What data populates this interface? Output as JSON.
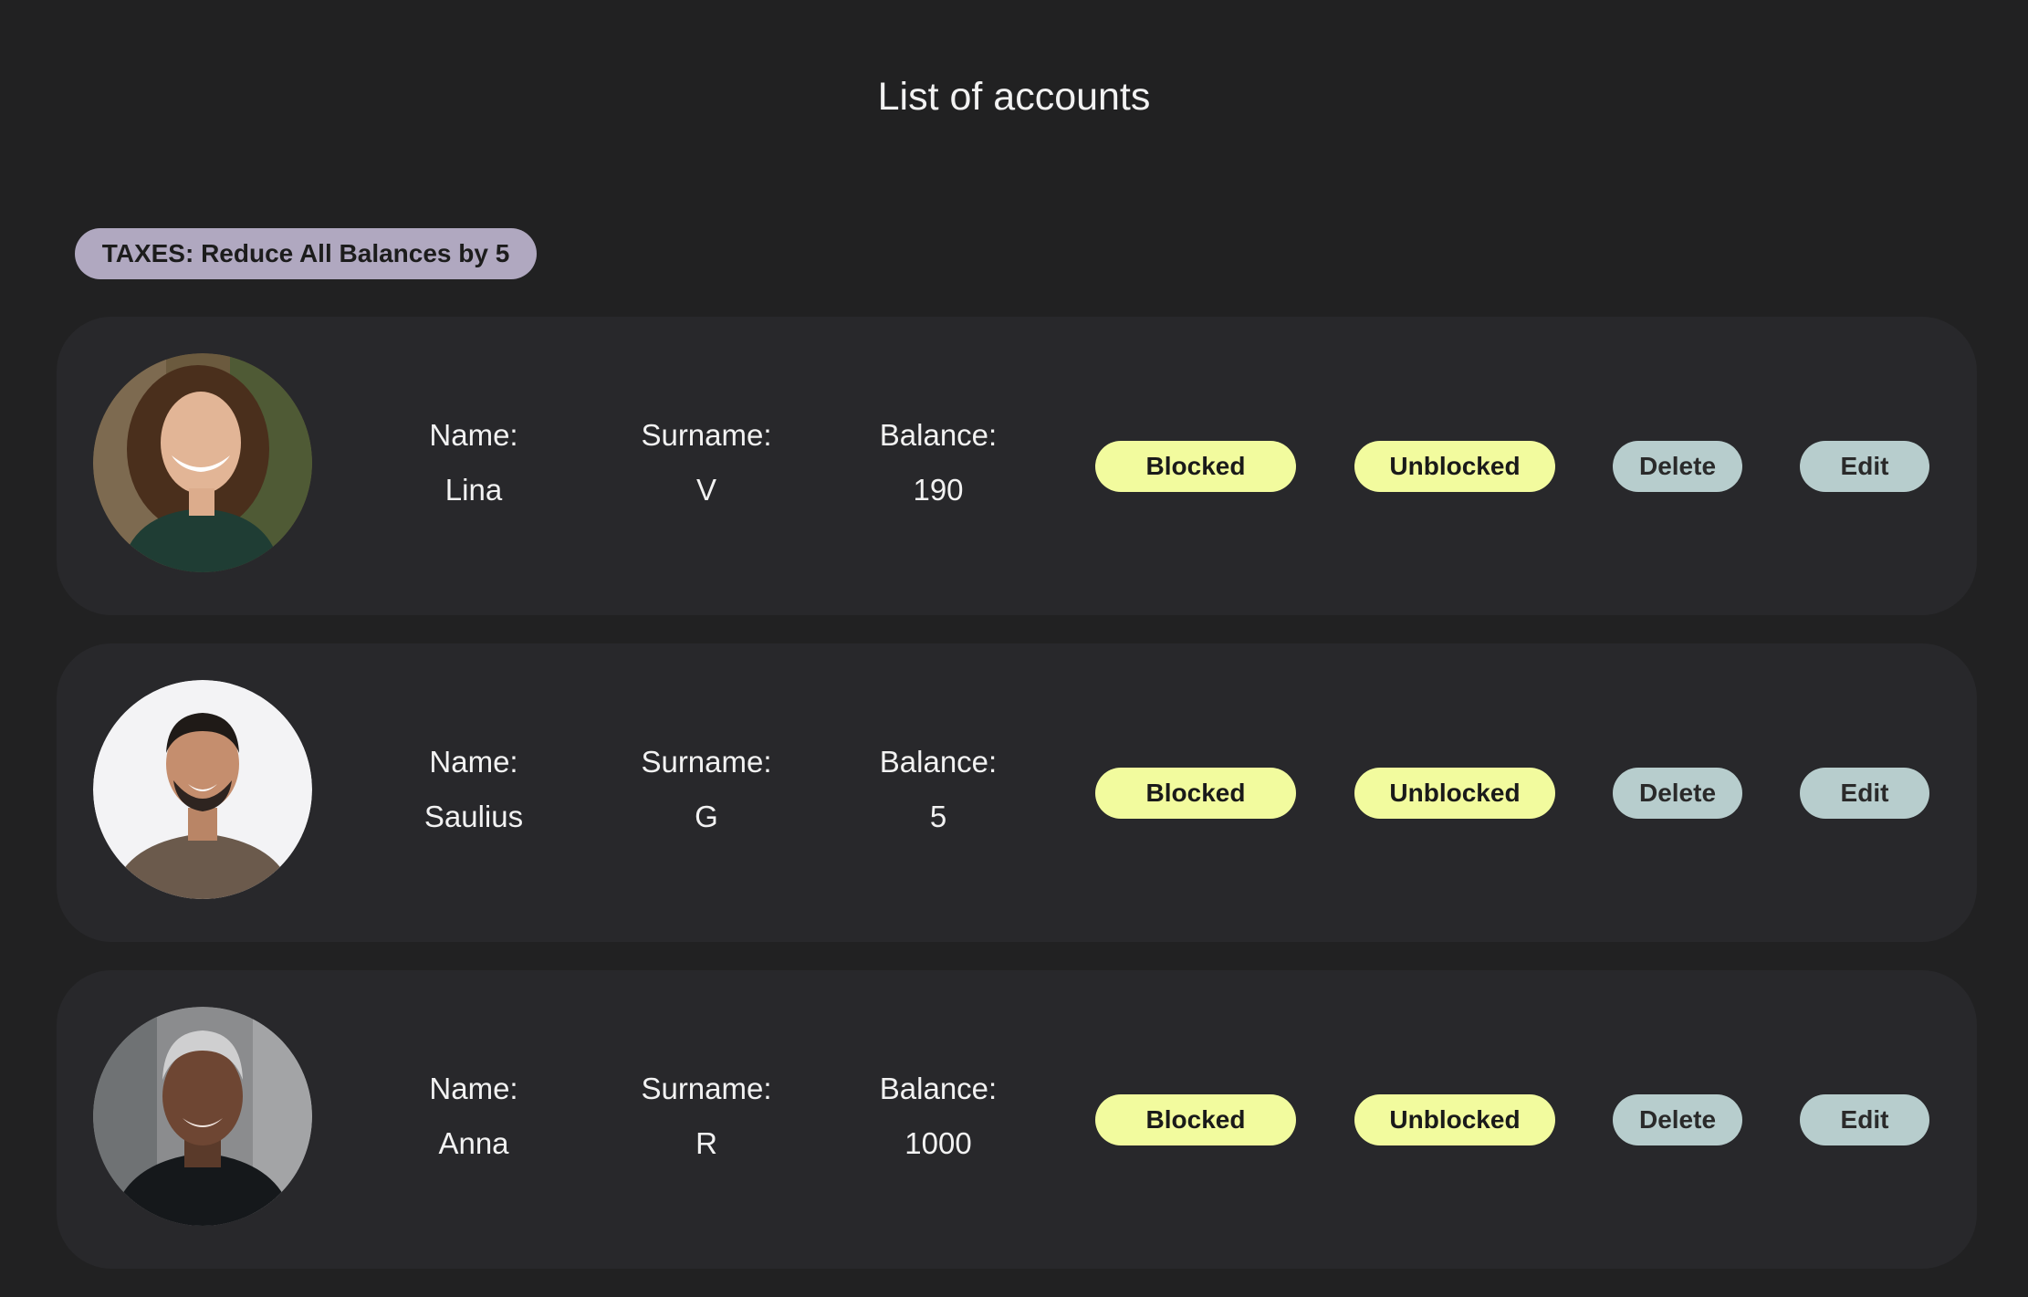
{
  "page": {
    "title": "List of accounts"
  },
  "toolbar": {
    "taxes_label": "TAXES: Reduce All Balances by 5"
  },
  "labels": {
    "name": "Name:",
    "surname": "Surname:",
    "balance": "Balance:"
  },
  "buttons": {
    "blocked": "Blocked",
    "unblocked": "Unblocked",
    "delete": "Delete",
    "edit": "Edit"
  },
  "accounts": [
    {
      "name": "Lina",
      "surname": "V",
      "balance": "190"
    },
    {
      "name": "Saulius",
      "surname": "G",
      "balance": "5"
    },
    {
      "name": "Anna",
      "surname": "R",
      "balance": "1000"
    }
  ],
  "colors": {
    "background": "#212122",
    "card": "#28282b",
    "taxes_button": "#b0a8c0",
    "status_button": "#f2fb9e",
    "action_button": "#b7cdcd"
  }
}
